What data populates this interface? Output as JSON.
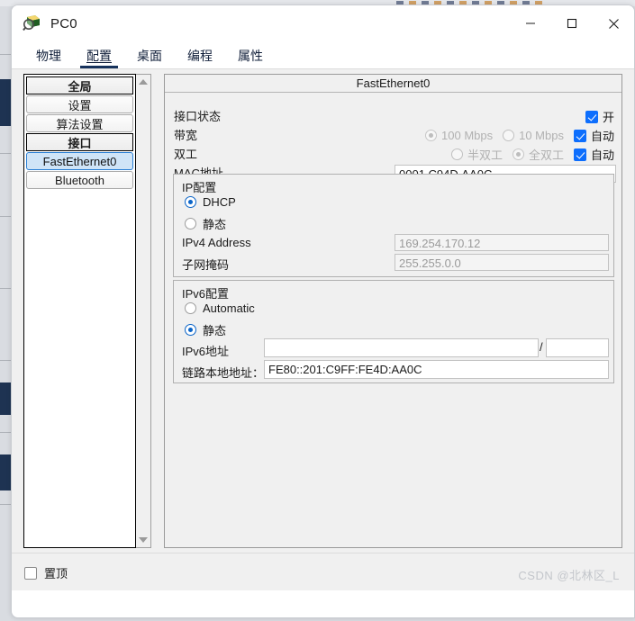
{
  "window": {
    "title": "PC0",
    "app_icon": "packet-tracer-device-icon",
    "minimize_label": "—",
    "maximize_label": "☐",
    "close_label": "✕"
  },
  "tabs": [
    {
      "label": "物理",
      "active": false
    },
    {
      "label": "配置",
      "active": true
    },
    {
      "label": "桌面",
      "active": false
    },
    {
      "label": "编程",
      "active": false
    },
    {
      "label": "属性",
      "active": false
    }
  ],
  "sidebar": {
    "items": [
      {
        "label": "全局",
        "type": "header",
        "selected": false
      },
      {
        "label": "设置",
        "type": "item",
        "selected": false
      },
      {
        "label": "算法设置",
        "type": "item",
        "selected": false
      },
      {
        "label": "接口",
        "type": "header",
        "selected": false
      },
      {
        "label": "FastEthernet0",
        "type": "item",
        "selected": true
      },
      {
        "label": "Bluetooth",
        "type": "item",
        "selected": false
      }
    ],
    "scroll_up": "scroll-up-arrow",
    "scroll_down": "scroll-down-arrow"
  },
  "panel": {
    "title": "FastEthernet0",
    "port_status": {
      "label": "接口状态",
      "on_label": "开",
      "checked": true
    },
    "bandwidth": {
      "label": "带宽",
      "option_100": "100 Mbps",
      "option_10": "10 Mbps",
      "option_100_selected": true,
      "option_10_selected": false,
      "auto_label": "自动",
      "auto_checked": true,
      "disabled": true
    },
    "duplex": {
      "label": "双工",
      "option_half": "半双工",
      "option_full": "全双工",
      "option_half_selected": false,
      "option_full_selected": true,
      "auto_label": "自动",
      "auto_checked": true,
      "disabled": true
    },
    "mac": {
      "label": "MAC地址",
      "value": "0001.C94D.AA0C"
    },
    "ip_config": {
      "title": "IP配置",
      "dhcp_label": "DHCP",
      "dhcp_selected": true,
      "static_label": "静态",
      "static_selected": false,
      "ipv4_label": "IPv4 Address",
      "ipv4_value": "169.254.170.12",
      "mask_label": "子网掩码",
      "mask_value": "255.255.0.0"
    },
    "ipv6_config": {
      "title": "IPv6配置",
      "auto_label": "Automatic",
      "auto_selected": false,
      "static_label": "静态",
      "static_selected": true,
      "address_label": "IPv6地址",
      "address_value": "",
      "prefix_separator": "/",
      "prefix_value": "",
      "link_local_label": "链路本地地址：",
      "link_local_value": "FE80::201:C9FF:FE4D:AA0C"
    }
  },
  "footer": {
    "pin_label": "置顶",
    "pin_checked": false,
    "watermark": "CSDN @北林区_L"
  },
  "colors": {
    "accent_blue": "#0d6efd",
    "tab_underline": "#16325c",
    "selection_bg": "#cfe4f7",
    "selection_border": "#2a7fd4",
    "disabled_text": "#b1b1b1",
    "watermark": "#c3c6cb"
  }
}
